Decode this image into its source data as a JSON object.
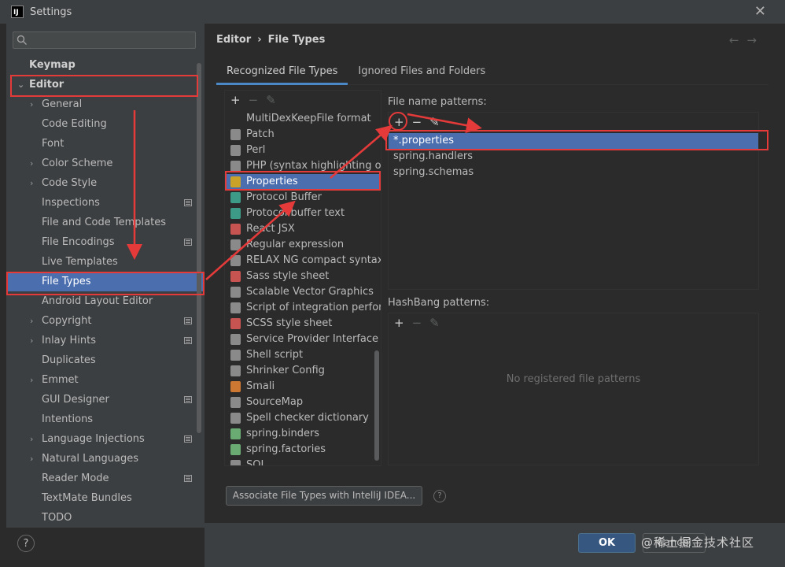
{
  "window": {
    "title": "Settings",
    "logo_text": "IJ"
  },
  "search": {
    "placeholder": "",
    "icon": "search-icon"
  },
  "sidebar": {
    "items": [
      {
        "label": "Keymap",
        "level": "top",
        "expandable": false
      },
      {
        "label": "Editor",
        "level": "top",
        "expandable": true,
        "expanded": true
      },
      {
        "label": "General",
        "level": "child",
        "expandable": true
      },
      {
        "label": "Code Editing",
        "level": "child"
      },
      {
        "label": "Font",
        "level": "child"
      },
      {
        "label": "Color Scheme",
        "level": "child",
        "expandable": true
      },
      {
        "label": "Code Style",
        "level": "child",
        "expandable": true
      },
      {
        "label": "Inspections",
        "level": "child",
        "settings_icon": true
      },
      {
        "label": "File and Code Templates",
        "level": "child"
      },
      {
        "label": "File Encodings",
        "level": "child",
        "settings_icon": true
      },
      {
        "label": "Live Templates",
        "level": "child"
      },
      {
        "label": "File Types",
        "level": "child",
        "selected": true
      },
      {
        "label": "Android Layout Editor",
        "level": "child"
      },
      {
        "label": "Copyright",
        "level": "child",
        "expandable": true,
        "settings_icon": true
      },
      {
        "label": "Inlay Hints",
        "level": "child",
        "expandable": true,
        "settings_icon": true
      },
      {
        "label": "Duplicates",
        "level": "child"
      },
      {
        "label": "Emmet",
        "level": "child",
        "expandable": true
      },
      {
        "label": "GUI Designer",
        "level": "child",
        "settings_icon": true
      },
      {
        "label": "Intentions",
        "level": "child"
      },
      {
        "label": "Language Injections",
        "level": "child",
        "expandable": true,
        "settings_icon": true
      },
      {
        "label": "Natural Languages",
        "level": "child",
        "expandable": true
      },
      {
        "label": "Reader Mode",
        "level": "child",
        "settings_icon": true
      },
      {
        "label": "TextMate Bundles",
        "level": "child"
      },
      {
        "label": "TODO",
        "level": "child"
      }
    ]
  },
  "breadcrumb": {
    "parent": "Editor",
    "separator": "›",
    "current": "File Types"
  },
  "tabs": [
    {
      "label": "Recognized File Types",
      "active": true
    },
    {
      "label": "Ignored Files and Folders",
      "active": false
    }
  ],
  "file_types": {
    "toolbar": {
      "add": "+",
      "remove": "−",
      "edit": "✎"
    },
    "items": [
      {
        "label": "MultiDexKeepFile format",
        "icon": "none",
        "color": ""
      },
      {
        "label": "Patch",
        "icon": "patch-file-icon",
        "color": "#8a8a8a"
      },
      {
        "label": "Perl",
        "icon": "perl-file-icon",
        "color": "#8a8a8a"
      },
      {
        "label": "PHP (syntax highlighting only)",
        "icon": "php-file-icon",
        "color": "#8a8a8a"
      },
      {
        "label": "Properties",
        "icon": "properties-file-icon",
        "color": "#c9a227",
        "selected": true
      },
      {
        "label": "Protocol Buffer",
        "icon": "protobuf-file-icon",
        "color": "#3d9a87"
      },
      {
        "label": "Protocol buffer text",
        "icon": "protobuf-text-file-icon",
        "color": "#3d9a87"
      },
      {
        "label": "React JSX",
        "icon": "jsx-file-icon",
        "color": "#c75450"
      },
      {
        "label": "Regular expression",
        "icon": "regex-file-icon",
        "color": "#8a8a8a"
      },
      {
        "label": "RELAX NG compact syntax",
        "icon": "rnc-file-icon",
        "color": "#8a8a8a"
      },
      {
        "label": "Sass style sheet",
        "icon": "sass-file-icon",
        "color": "#c75450"
      },
      {
        "label": "Scalable Vector Graphics",
        "icon": "svg-file-icon",
        "color": "#8a8a8a"
      },
      {
        "label": "Script of integration performa",
        "icon": "script-file-icon",
        "color": "#8a8a8a"
      },
      {
        "label": "SCSS style sheet",
        "icon": "scss-file-icon",
        "color": "#c75450"
      },
      {
        "label": "Service Provider Interface",
        "icon": "spi-file-icon",
        "color": "#8a8a8a"
      },
      {
        "label": "Shell script",
        "icon": "shell-file-icon",
        "color": "#8a8a8a"
      },
      {
        "label": "Shrinker Config",
        "icon": "shrinker-file-icon",
        "color": "#8a8a8a"
      },
      {
        "label": "Smali",
        "icon": "smali-file-icon",
        "color": "#cc7832"
      },
      {
        "label": "SourceMap",
        "icon": "sourcemap-file-icon",
        "color": "#8a8a8a"
      },
      {
        "label": "Spell checker dictionary",
        "icon": "dictionary-file-icon",
        "color": "#8a8a8a"
      },
      {
        "label": "spring.binders",
        "icon": "spring-leaf-icon",
        "color": "#6aab73"
      },
      {
        "label": "spring.factories",
        "icon": "spring-leaf-icon",
        "color": "#6aab73"
      },
      {
        "label": "SQL",
        "icon": "sql-file-icon",
        "color": "#8a8a8a"
      }
    ]
  },
  "patterns": {
    "label": "File name patterns:",
    "toolbar": {
      "add": "+",
      "remove": "−",
      "edit": "✎"
    },
    "items": [
      {
        "label": "*.properties",
        "selected": true
      },
      {
        "label": "spring.handlers"
      },
      {
        "label": "spring.schemas"
      }
    ]
  },
  "hashbang": {
    "label": "HashBang patterns:",
    "toolbar": {
      "add": "+",
      "remove": "−",
      "edit": "✎"
    },
    "empty_text": "No registered file patterns"
  },
  "associate_button": "Associate File Types with IntelliJ IDEA...",
  "footer": {
    "help": "?",
    "ok": "OK",
    "cancel": "Cancel"
  },
  "watermark": "@稀土掘金技术社区",
  "colors": {
    "selection": "#4b6eaf",
    "annotation": "#e53a3a",
    "panel_bg": "#3c3f41",
    "content_bg": "#2b2b2b"
  }
}
